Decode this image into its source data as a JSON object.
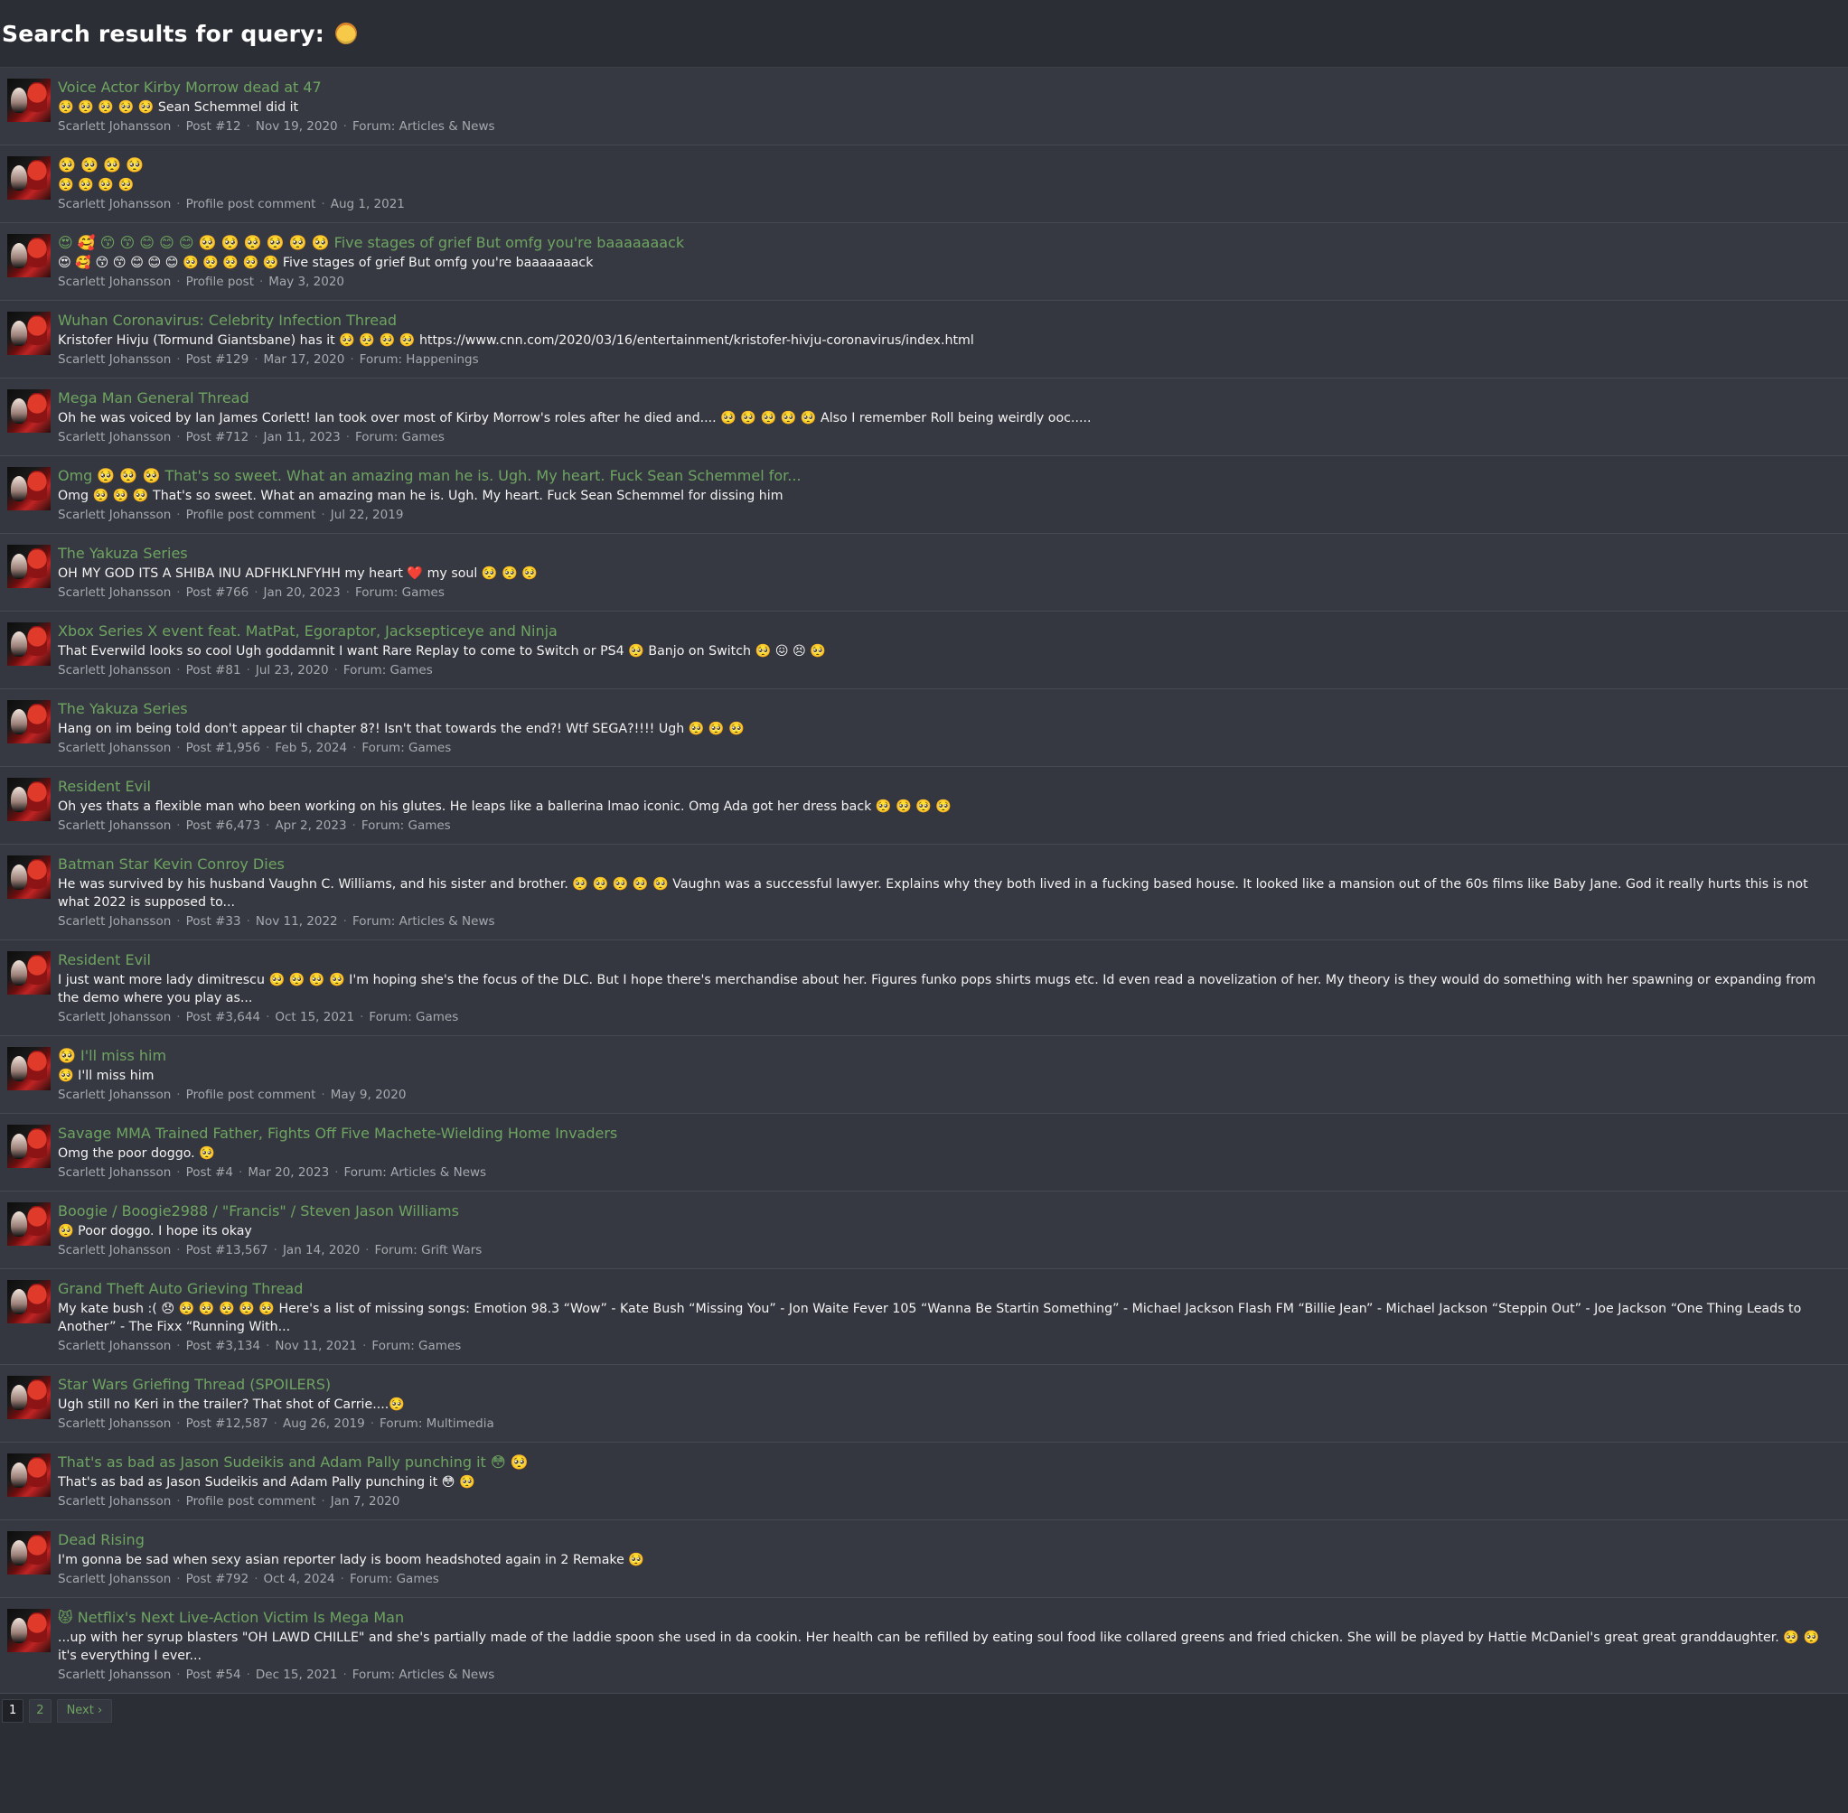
{
  "page": {
    "title": "Search results for query:",
    "query_emoji": "🥺"
  },
  "results": [
    {
      "title": "Voice Actor Kirby Morrow dead at 47",
      "snippet": "🥺 🥺 🥺 🥺 🥺 Sean Schemmel did it",
      "meta": [
        "Scarlett Johansson",
        "Post #12",
        "Nov 19, 2020",
        "Forum: Articles & News"
      ]
    },
    {
      "title": "🥺 🥺 🥺 🥺",
      "snippet": "🥺 🥺 🥺 🥺",
      "meta": [
        "Scarlett Johansson",
        "Profile post comment",
        "Aug 1, 2021"
      ]
    },
    {
      "title": "😍 🥰 😙 😙 😊 😊 😊 🥺 🥺 🥺 🥺 🥺 🥺 Five stages of grief But omfg you're baaaaaaack",
      "snippet": "😍 🥰 😙 😙 😊 😊 😊 🥺 🥺 🥺 🥺 🥺 Five stages of grief But omfg you're baaaaaaack",
      "meta": [
        "Scarlett Johansson",
        "Profile post",
        "May 3, 2020"
      ]
    },
    {
      "title": "Wuhan Coronavirus: Celebrity Infection Thread",
      "snippet": "Kristofer Hivju (Tormund Giantsbane) has it 🥺 🥺 🥺 🥺 https://www.cnn.com/2020/03/16/entertainment/kristofer-hivju-coronavirus/index.html",
      "meta": [
        "Scarlett Johansson",
        "Post #129",
        "Mar 17, 2020",
        "Forum: Happenings"
      ]
    },
    {
      "title": "Mega Man General Thread",
      "snippet": "Oh he was voiced by Ian James Corlett! Ian took over most of Kirby Morrow's roles after he died and.... 🥺 🥺 🥺 🥺 🥺 Also I remember Roll being weirdly ooc.....",
      "meta": [
        "Scarlett Johansson",
        "Post #712",
        "Jan 11, 2023",
        "Forum: Games"
      ]
    },
    {
      "title": "Omg 🥺 🥺 🥺 That's so sweet. What an amazing man he is. Ugh. My heart. Fuck Sean Schemmel for...",
      "snippet": "Omg 🥺 🥺 🥺 That's so sweet. What an amazing man he is. Ugh. My heart. Fuck Sean Schemmel for dissing him",
      "meta": [
        "Scarlett Johansson",
        "Profile post comment",
        "Jul 22, 2019"
      ]
    },
    {
      "title": "The Yakuza Series",
      "snippet": "OH MY GOD ITS A SHIBA INU ADFHKLNFYHH my heart ❤️ my soul 🥺 🥺 🥺",
      "meta": [
        "Scarlett Johansson",
        "Post #766",
        "Jan 20, 2023",
        "Forum: Games"
      ]
    },
    {
      "title": "Xbox Series X event feat. MatPat, Egoraptor, Jacksepticeye and Ninja",
      "snippet": "That Everwild looks so cool Ugh goddamnit I want Rare Replay to come to Switch or PS4 🥺 Banjo on Switch 🥺 😖 😣 🥺",
      "meta": [
        "Scarlett Johansson",
        "Post #81",
        "Jul 23, 2020",
        "Forum: Games"
      ]
    },
    {
      "title": "The Yakuza Series",
      "snippet": "Hang on im being told don't appear til chapter 8?! Isn't that towards the end?! Wtf SEGA?!!!! Ugh 🥺 🥺 🥺",
      "meta": [
        "Scarlett Johansson",
        "Post #1,956",
        "Feb 5, 2024",
        "Forum: Games"
      ]
    },
    {
      "title": "Resident Evil",
      "snippet": "Oh yes thats a flexible man who been working on his glutes. He leaps like a ballerina lmao iconic. Omg Ada got her dress back 🥺 🥺 🥺 🥺",
      "meta": [
        "Scarlett Johansson",
        "Post #6,473",
        "Apr 2, 2023",
        "Forum: Games"
      ]
    },
    {
      "title": "Batman Star Kevin Conroy Dies",
      "snippet": "He was survived by his husband Vaughn C. Williams, and his sister and brother. 🥺 🥺 🥺 🥺 🥺 Vaughn was a successful lawyer. Explains why they both lived in a fucking based house. It looked like a mansion out of the 60s films like Baby Jane. God it really hurts this is not what 2022 is supposed to...",
      "meta": [
        "Scarlett Johansson",
        "Post #33",
        "Nov 11, 2022",
        "Forum: Articles & News"
      ]
    },
    {
      "title": "Resident Evil",
      "snippet": "I just want more lady dimitrescu 🥺 🥺 🥺 🥺 I'm hoping she's the focus of the DLC. But I hope there's merchandise about her. Figures funko pops shirts mugs etc. Id even read a novelization of her. My theory is they would do something with her spawning or expanding from the demo where you play as...",
      "meta": [
        "Scarlett Johansson",
        "Post #3,644",
        "Oct 15, 2021",
        "Forum: Games"
      ]
    },
    {
      "title": "🥺 I'll miss him",
      "snippet": "🥺 I'll miss him",
      "meta": [
        "Scarlett Johansson",
        "Profile post comment",
        "May 9, 2020"
      ]
    },
    {
      "title": "Savage MMA Trained Father, Fights Off Five Machete-Wielding Home Invaders",
      "snippet": "Omg the poor doggo. 🥺",
      "meta": [
        "Scarlett Johansson",
        "Post #4",
        "Mar 20, 2023",
        "Forum: Articles & News"
      ]
    },
    {
      "title": "Boogie / Boogie2988 / \"Francis\" / Steven Jason Williams",
      "snippet": "🥺 Poor doggo. I hope its okay",
      "meta": [
        "Scarlett Johansson",
        "Post #13,567",
        "Jan 14, 2020",
        "Forum: Grift Wars"
      ]
    },
    {
      "title": "Grand Theft Auto Grieving Thread",
      "snippet": "My kate bush :( 😞 🥺 🥺 🥺 🥺 🥺 Here's a list of missing songs: Emotion 98.3 “Wow” - Kate Bush “Missing You” - Jon Waite Fever 105 “Wanna Be Startin Something” - Michael Jackson Flash FM “Billie Jean” - Michael Jackson “Steppin Out” - Joe Jackson “One Thing Leads to Another” - The Fixx “Running With...",
      "meta": [
        "Scarlett Johansson",
        "Post #3,134",
        "Nov 11, 2021",
        "Forum: Games"
      ]
    },
    {
      "title": "Star Wars Griefing Thread (SPOILERS)",
      "snippet": "Ugh still no Keri in the trailer? That shot of Carrie....🥺",
      "meta": [
        "Scarlett Johansson",
        "Post #12,587",
        "Aug 26, 2019",
        "Forum: Multimedia"
      ]
    },
    {
      "title": "That's as bad as Jason Sudeikis and Adam Pally punching it 😳 🥺",
      "snippet": "That's as bad as Jason Sudeikis and Adam Pally punching it 😳 🥺",
      "meta": [
        "Scarlett Johansson",
        "Profile post comment",
        "Jan 7, 2020"
      ]
    },
    {
      "title": "Dead Rising",
      "snippet": "I'm gonna be sad when sexy asian reporter lady is boom headshoted again in 2 Remake 🥺",
      "meta": [
        "Scarlett Johansson",
        "Post #792",
        "Oct 4, 2024",
        "Forum: Games"
      ]
    },
    {
      "title": "😾 Netflix's Next Live-Action Victim Is Mega Man",
      "snippet": "...up with her syrup blasters \"OH LAWD CHILLE\" and she's partially made of the laddie spoon she used in da cookin. Her health can be refilled by eating soul food like collared greens and fried chicken. She will be played by Hattie McDaniel's great great granddaughter. 🥺 🥺 it's everything I ever...",
      "meta": [
        "Scarlett Johansson",
        "Post #54",
        "Dec 15, 2021",
        "Forum: Articles & News"
      ]
    }
  ],
  "pagination": {
    "current": "1",
    "pages": [
      "2"
    ],
    "next_label": "Next ›"
  }
}
